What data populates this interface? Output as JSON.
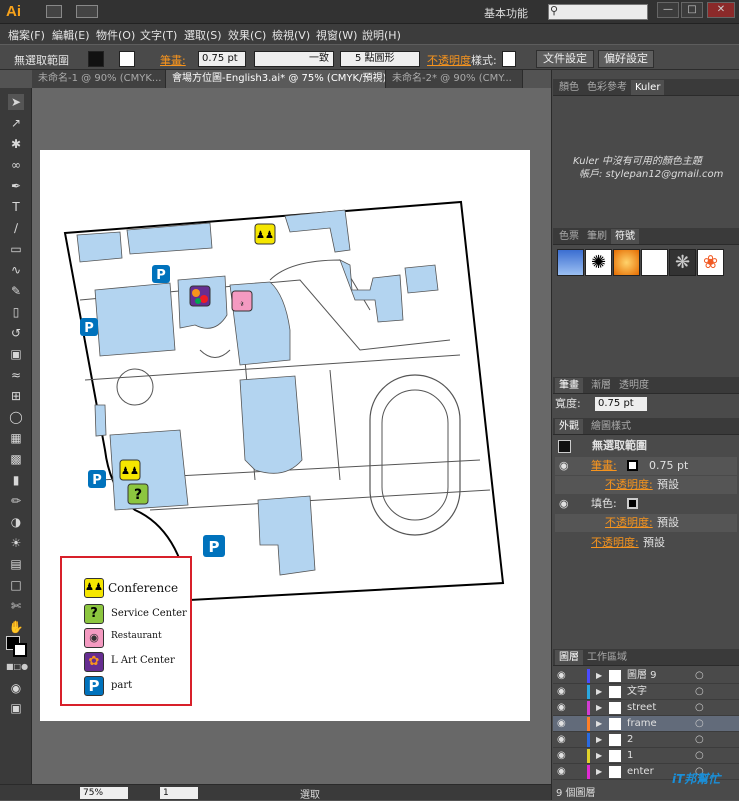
{
  "app": {
    "logo": "Ai",
    "workspace": "基本功能",
    "search_placeholder": ""
  },
  "menu": [
    "檔案(F)",
    "編輯(E)",
    "物件(O)",
    "文字(T)",
    "選取(S)",
    "效果(C)",
    "檢視(V)",
    "視窗(W)",
    "說明(H)"
  ],
  "control": {
    "selection": "無選取範圍",
    "stroke_label": "筆畫:",
    "stroke_value": "0.75 pt",
    "stroke_style": "一致",
    "brush": "5 點圓形",
    "opacity_label": "不透明度",
    "style_label": "樣式:",
    "doc_setup": "文件設定",
    "prefs": "偏好設定"
  },
  "tabs": [
    {
      "label": "未命名-1 @ 90% (CMYK...",
      "active": false
    },
    {
      "label": "會場方位圖-English3.ai* @ 75% (CMYK/預視)",
      "active": true
    },
    {
      "label": "未命名-2* @ 90% (CMY...",
      "active": false
    }
  ],
  "map": {
    "legend": [
      {
        "icon": "conference-icon",
        "label": "Conference",
        "color": "#f5e600"
      },
      {
        "icon": "service-icon",
        "label": "Service Center",
        "color": "#8cc63f"
      },
      {
        "icon": "restaurant-icon",
        "label": "Restaurant",
        "color": "#f49ac1"
      },
      {
        "icon": "art-icon",
        "label": "L Art Center",
        "color": "#662d91"
      },
      {
        "icon": "parking-icon",
        "label": "part",
        "color": "#0072bc"
      }
    ],
    "parking_symbol": "P",
    "service_symbol": "?",
    "building_color": "#b3d4f0"
  },
  "panels": {
    "color_tabs": [
      "顏色",
      "色彩參考",
      "Kuler"
    ],
    "kuler_msg1": "Kuler 中沒有可用的顏色主題",
    "kuler_msg2": "帳戶: stylepan12@gmail.com",
    "swatch_tabs": [
      "色票",
      "筆刷",
      "符號"
    ],
    "stroke_tabs": [
      "筆畫",
      "漸層",
      "透明度"
    ],
    "width_label": "寬度:",
    "width_value": "0.75 pt",
    "appearance_tabs": [
      "外觀",
      "繪圖樣式"
    ],
    "appearance_title": "無選取範圍",
    "appearance_rows": [
      {
        "label": "筆畫:",
        "value": "0.75 pt"
      },
      {
        "label": "不透明度:",
        "value": "預設"
      },
      {
        "label": "填色:",
        "value": ""
      },
      {
        "label": "不透明度:",
        "value": "預設"
      },
      {
        "label": "不透明度:",
        "value": "預設"
      }
    ],
    "layer_tabs": [
      "圖層",
      "工作區域"
    ],
    "layers": [
      {
        "name": "圖層 9",
        "color": "#4b4bff",
        "selected": false
      },
      {
        "name": "文字",
        "color": "#2aa8e0",
        "selected": false
      },
      {
        "name": "street",
        "color": "#d23cd2",
        "selected": false
      },
      {
        "name": "frame",
        "color": "#ff7f27",
        "selected": true
      },
      {
        "name": "2",
        "color": "#2a6ae0",
        "selected": false
      },
      {
        "name": "1",
        "color": "#e0d22a",
        "selected": false
      },
      {
        "name": "enter",
        "color": "#e02ad2",
        "selected": false
      }
    ],
    "layer_count": "9 個圖層"
  },
  "status": {
    "zoom": "75%",
    "page": "1",
    "mode": "選取"
  },
  "watermark": "iT邦幫忙"
}
